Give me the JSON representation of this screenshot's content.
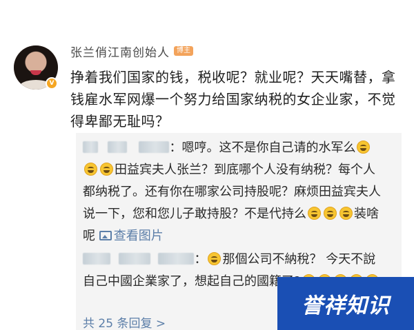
{
  "post": {
    "author": "张兰俏江南创始人",
    "author_tag": "博主",
    "verified_icon": "v-badge-icon",
    "text": "挣着我们国家的钱，税收呢？就业呢？天天嘴替，拿钱雇水军网爆一个努力给国家纳税的女企业家，不觉得卑鄙无耻吗？"
  },
  "replies": [
    {
      "text_a": "：嗯哼。这不是你自己请的水军么",
      "text_b": "田益宾夫人张兰？到底哪个人没有纳税？每个人都纳税了。还有你在哪家公司持股呢？麻烦田益宾夫人说一下，您和您儿子敢持股？不是代持么",
      "text_c": "装啥呢",
      "view_image_label": "查看图片"
    },
    {
      "text_a": "：",
      "text_b": "那個公司不納稅？ 今天不說自己中國企業家了，想起自己的國籍了?"
    }
  ],
  "more_replies_label": "共 25 条回复 >",
  "watermark_text": "誉祥知识",
  "colors": {
    "link": "#5b7ea8",
    "reply_background": "#f4f4f4",
    "tag": "#f3a35b",
    "watermark_background": "#1a4fb4"
  }
}
